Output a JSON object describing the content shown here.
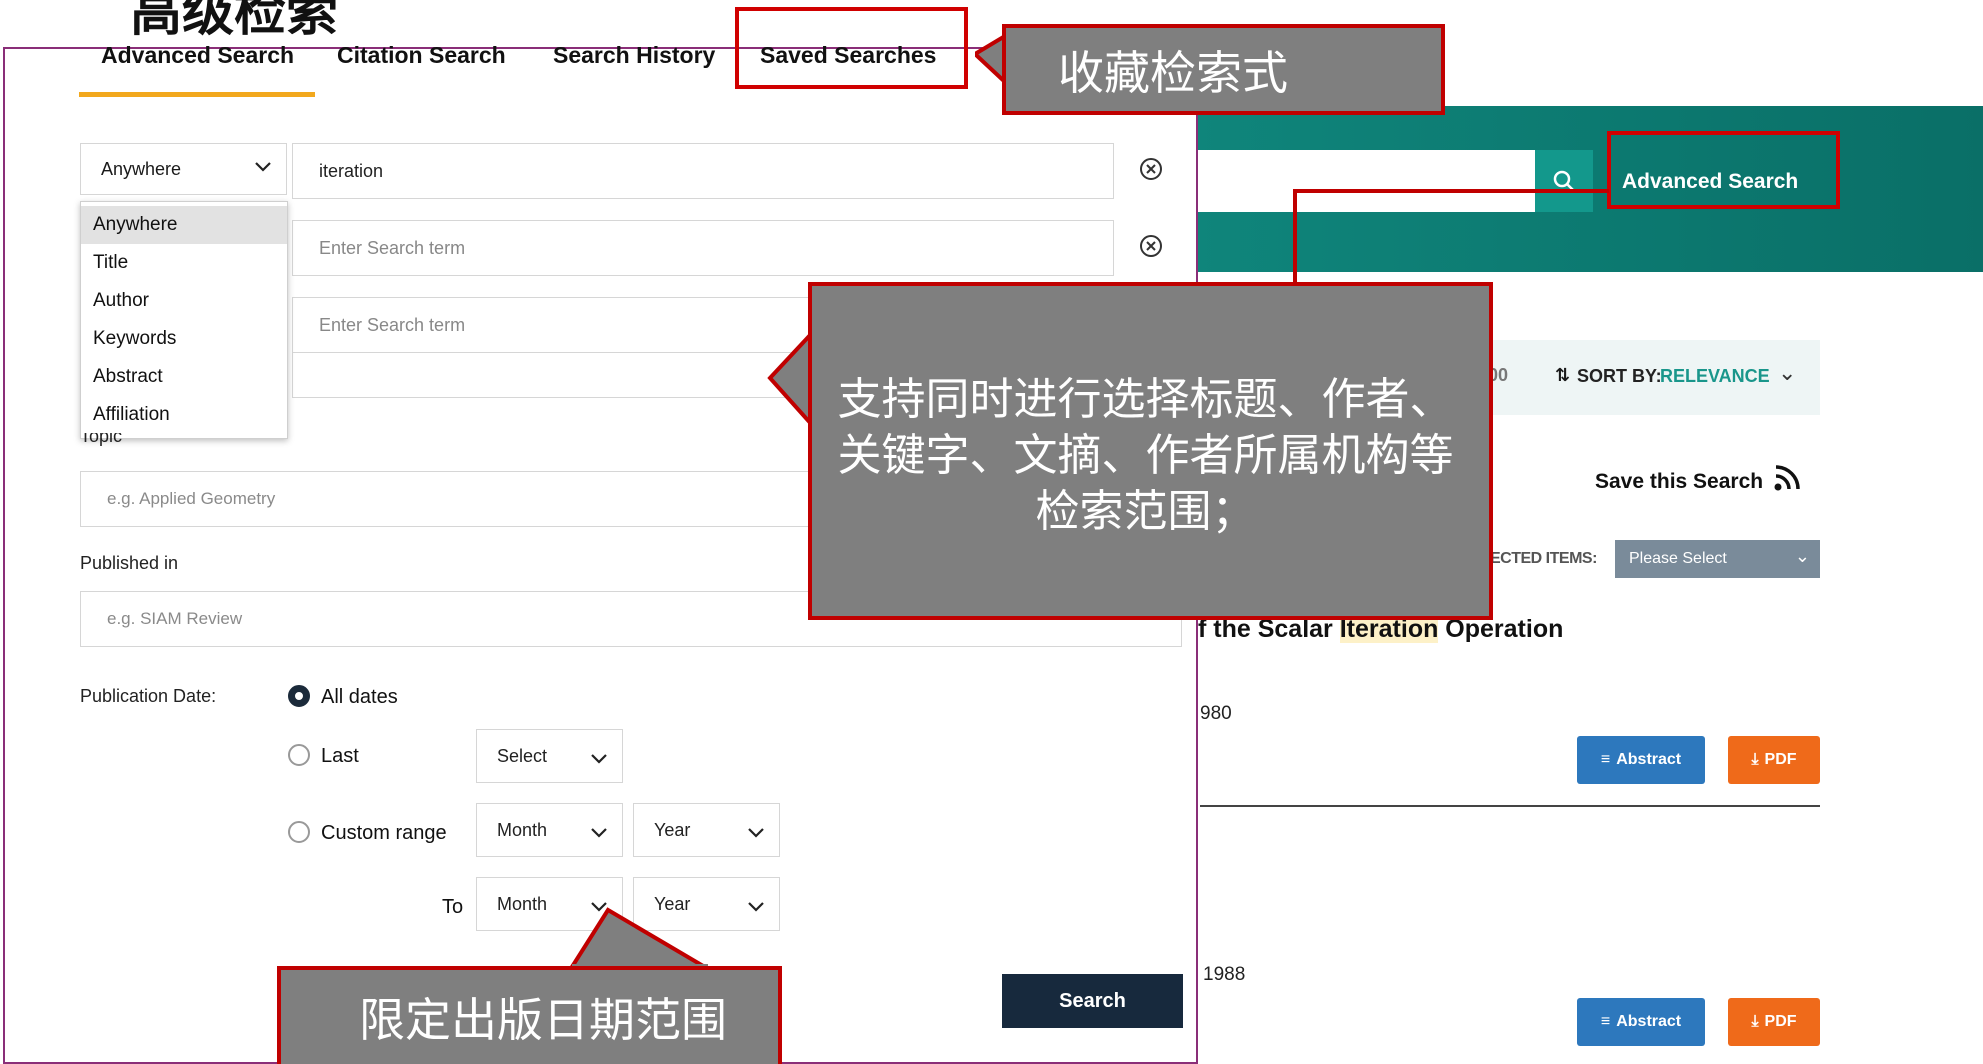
{
  "slide_title_crop": "高级检索",
  "tabs": [
    {
      "label": "Advanced Search"
    },
    {
      "label": "Citation Search"
    },
    {
      "label": "Search History"
    },
    {
      "label": "Saved Searches"
    }
  ],
  "search_rows": [
    {
      "field": "Anywhere",
      "value": "iteration",
      "placeholder": ""
    },
    {
      "field": "",
      "value": "",
      "placeholder": "Enter Search term"
    },
    {
      "field": "",
      "value": "",
      "placeholder": "Enter Search term"
    }
  ],
  "field_dropdown": {
    "options": [
      "Anywhere",
      "Title",
      "Author",
      "Keywords",
      "Abstract",
      "Affiliation"
    ],
    "selected": "Anywhere"
  },
  "topic": {
    "label": "Topic",
    "placeholder": "e.g. Applied Geometry"
  },
  "published_in": {
    "label": "Published in",
    "placeholder": "e.g. SIAM Review"
  },
  "publication_date": {
    "label": "Publication Date:",
    "options": [
      "All dates",
      "Last",
      "Custom range"
    ],
    "selected": "All dates",
    "last_select": "Select",
    "month": "Month",
    "year": "Year",
    "to_label": "To"
  },
  "search_button": "Search",
  "background_page": {
    "advanced_search_link": "Advanced Search",
    "sort_partial": "00",
    "sort_label": "SORT BY:",
    "sort_value": "RELEVANCE",
    "save_search": "Save this Search",
    "selected_items_label": "ECTED ITEMS:",
    "please_select": "Please Select",
    "result_title_before": "f the Scalar ",
    "result_title_highlight": "Iteration",
    "result_title_after": " Operation",
    "year_1": "980",
    "year_2": "1988",
    "abstract_label": "Abstract",
    "pdf_label": "PDF"
  },
  "annotations": {
    "saved_searches": "收藏检索式",
    "search_fields": "支持同时进行选择标题、作者、关键字、文摘、作者所属机构等检索范围；",
    "date_range": "限定出版日期范围"
  },
  "colors": {
    "teal": "#0f857b",
    "tab_underline": "#f2a81d",
    "callout_fill": "#7f7f7f",
    "callout_border": "#c00000",
    "abstract_button": "#2d78bd",
    "pdf_button": "#ef6a1a",
    "search_button": "#17293d"
  }
}
